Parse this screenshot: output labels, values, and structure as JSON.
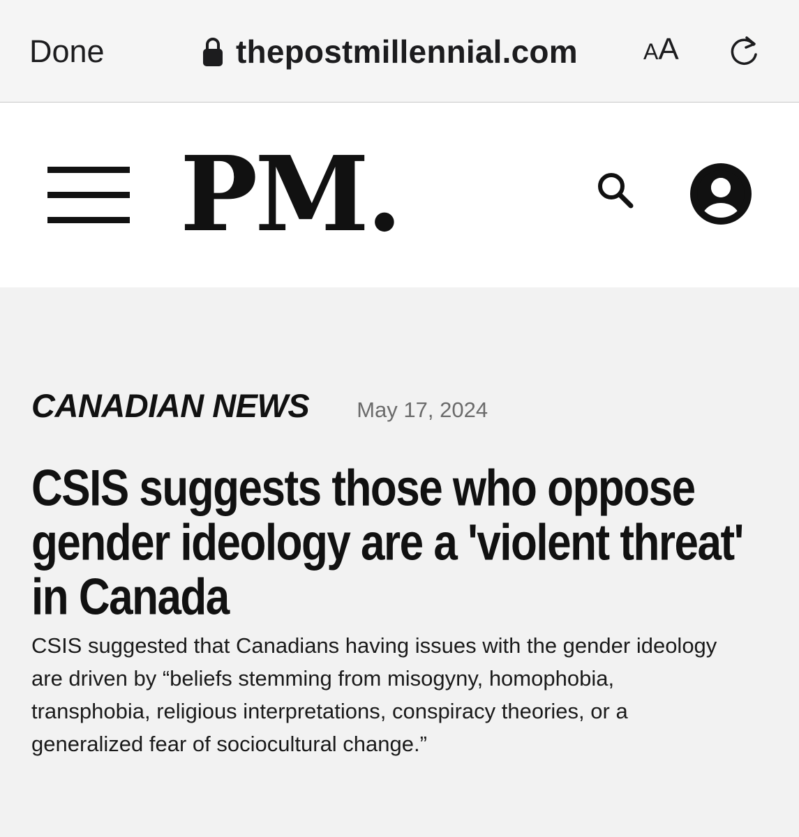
{
  "browser": {
    "done_label": "Done",
    "url": "thepostmillennial.com",
    "text_size_small": "A",
    "text_size_big": "A"
  },
  "site": {
    "logo": "PM."
  },
  "article": {
    "category": "CANADIAN NEWS",
    "date": "May 17, 2024",
    "headline": "CSIS suggests those who oppose gender ideology are a 'violent threat' in Canada",
    "summary": "CSIS suggested that Canadians having issues with the gender ideology are driven by “beliefs stemming from misogyny, homophobia, transphobia, religious interpretations, conspiracy theories, or a generalized fear of sociocultural change.”"
  }
}
